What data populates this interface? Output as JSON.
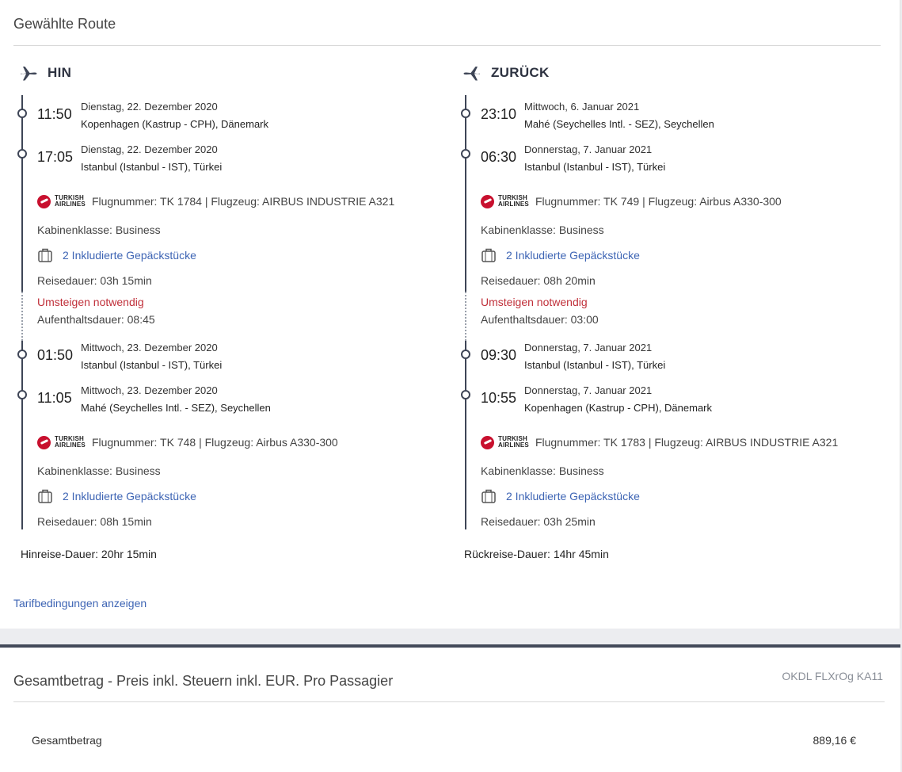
{
  "route": {
    "title": "Gewählte Route",
    "tarif_link": "Tarifbedingungen anzeigen",
    "outbound": {
      "label": "HIN",
      "icon": "plane-departure-icon",
      "segments": [
        {
          "dep_time": "11:50",
          "dep_date": "Dienstag, 22. Dezember 2020",
          "dep_place": "Kopenhagen (Kastrup - CPH), Dänemark",
          "arr_time": "17:05",
          "arr_date": "Dienstag, 22. Dezember 2020",
          "arr_place": "Istanbul (Istanbul - IST), Türkei",
          "airline_logo_text": [
            "TURKISH",
            "AIRLINES"
          ],
          "flight_info": "Flugnummer: TK 1784 | Flugzeug: AIRBUS INDUSTRIE A321",
          "cabin": "Kabinenklasse: Business",
          "baggage": "2 Inkludierte Gepäckstücke",
          "duration": "Reisedauer: 03h 15min"
        },
        {
          "dep_time": "01:50",
          "dep_date": "Mittwoch, 23. Dezember 2020",
          "dep_place": "Istanbul (Istanbul - IST), Türkei",
          "arr_time": "11:05",
          "arr_date": "Mittwoch, 23. Dezember 2020",
          "arr_place": "Mahé (Seychelles Intl. - SEZ), Seychellen",
          "airline_logo_text": [
            "TURKISH",
            "AIRLINES"
          ],
          "flight_info": "Flugnummer: TK 748 | Flugzeug: Airbus A330-300",
          "cabin": "Kabinenklasse: Business",
          "baggage": "2 Inkludierte Gepäckstücke",
          "duration": "Reisedauer: 08h 15min"
        }
      ],
      "transfer": {
        "warning": "Umsteigen notwendig",
        "layover": "Aufenthaltsdauer: 08:45"
      },
      "total_duration": "Hinreise-Dauer: 20hr 15min"
    },
    "return": {
      "label": "ZURÜCK",
      "icon": "plane-arrival-icon",
      "segments": [
        {
          "dep_time": "23:10",
          "dep_date": "Mittwoch, 6. Januar 2021",
          "dep_place": "Mahé (Seychelles Intl. - SEZ), Seychellen",
          "arr_time": "06:30",
          "arr_date": "Donnerstag, 7. Januar 2021",
          "arr_place": "Istanbul (Istanbul - IST), Türkei",
          "airline_logo_text": [
            "TURKISH",
            "AIRLINES"
          ],
          "flight_info": "Flugnummer: TK 749 | Flugzeug: Airbus A330-300",
          "cabin": "Kabinenklasse: Business",
          "baggage": "2 Inkludierte Gepäckstücke",
          "duration": "Reisedauer: 08h 20min"
        },
        {
          "dep_time": "09:30",
          "dep_date": "Donnerstag, 7. Januar 2021",
          "dep_place": "Istanbul (Istanbul - IST), Türkei",
          "arr_time": "10:55",
          "arr_date": "Donnerstag, 7. Januar 2021",
          "arr_place": "Kopenhagen (Kastrup - CPH), Dänemark",
          "airline_logo_text": [
            "TURKISH",
            "AIRLINES"
          ],
          "flight_info": "Flugnummer: TK 1783 | Flugzeug: AIRBUS INDUSTRIE A321",
          "cabin": "Kabinenklasse: Business",
          "baggage": "2 Inkludierte Gepäckstücke",
          "duration": "Reisedauer: 03h 25min"
        }
      ],
      "transfer": {
        "warning": "Umsteigen notwendig",
        "layover": "Aufenthaltsdauer: 03:00"
      },
      "total_duration": "Rückreise-Dauer: 14hr 45min"
    }
  },
  "total": {
    "title": "Gesamtbetrag - Preis inkl. Steuern inkl. EUR. Pro Passagier",
    "code": "OKDL FLXrOg KA11",
    "label": "Gesamtbetrag",
    "value": "889,16 €"
  },
  "colors": {
    "accent_link": "#3d64b4",
    "warning": "#c0303a",
    "timeline": "#3e4556",
    "airline_red": "#c8102e"
  }
}
